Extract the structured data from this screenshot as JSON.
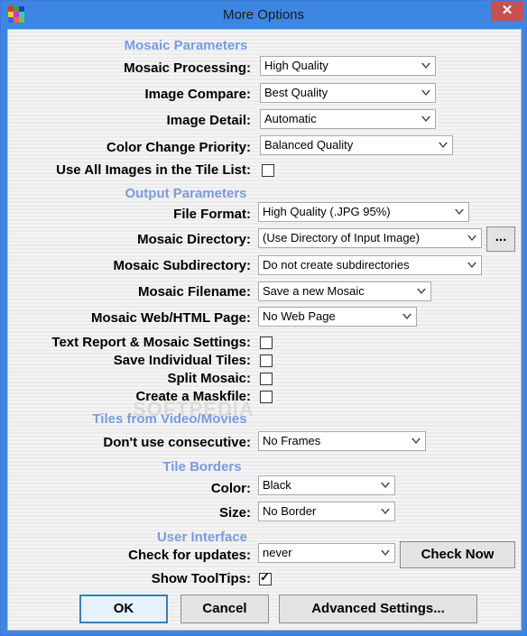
{
  "window": {
    "title": "More Options",
    "close": "✕"
  },
  "sections": {
    "mosaic": "Mosaic Parameters",
    "output": "Output Parameters",
    "video": "Tiles from Video/Movies",
    "borders": "Tile Borders",
    "ui": "User Interface"
  },
  "fields": {
    "mosaic_processing": {
      "label": "Mosaic Processing:",
      "value": "High Quality"
    },
    "image_compare": {
      "label": "Image Compare:",
      "value": "Best Quality"
    },
    "image_detail": {
      "label": "Image Detail:",
      "value": "Automatic"
    },
    "color_change": {
      "label": "Color Change Priority:",
      "value": "Balanced Quality"
    },
    "use_all_images": {
      "label": "Use All Images in the Tile List:",
      "checked": false
    },
    "file_format": {
      "label": "File Format:",
      "value": "High Quality (.JPG  95%)"
    },
    "mosaic_directory": {
      "label": "Mosaic Directory:",
      "value": "(Use Directory of Input Image)",
      "browse": "..."
    },
    "mosaic_subdirectory": {
      "label": "Mosaic Subdirectory:",
      "value": "Do not create subdirectories"
    },
    "mosaic_filename": {
      "label": "Mosaic Filename:",
      "value": "Save a new Mosaic"
    },
    "web_page": {
      "label": "Mosaic Web/HTML Page:",
      "value": "No Web Page"
    },
    "text_report": {
      "label": "Text Report & Mosaic Settings:",
      "checked": false
    },
    "save_tiles": {
      "label": "Save Individual Tiles:",
      "checked": false
    },
    "split_mosaic": {
      "label": "Split Mosaic:",
      "checked": false
    },
    "maskfile": {
      "label": "Create a Maskfile:",
      "checked": false
    },
    "consecutive": {
      "label": "Don't use consecutive:",
      "value": "No Frames"
    },
    "border_color": {
      "label": "Color:",
      "value": "Black"
    },
    "border_size": {
      "label": "Size:",
      "value": "No Border"
    },
    "updates": {
      "label": "Check for updates:",
      "value": "never",
      "button": "Check Now"
    },
    "tooltips": {
      "label": "Show ToolTips:",
      "checked": true
    }
  },
  "buttons": {
    "ok": "OK",
    "cancel": "Cancel",
    "advanced": "Advanced Settings..."
  },
  "watermark": "SOFTPEDIA",
  "colors": {
    "titlebar": "#3d86e3",
    "section": "#7a9be0",
    "close": "#c75050"
  }
}
